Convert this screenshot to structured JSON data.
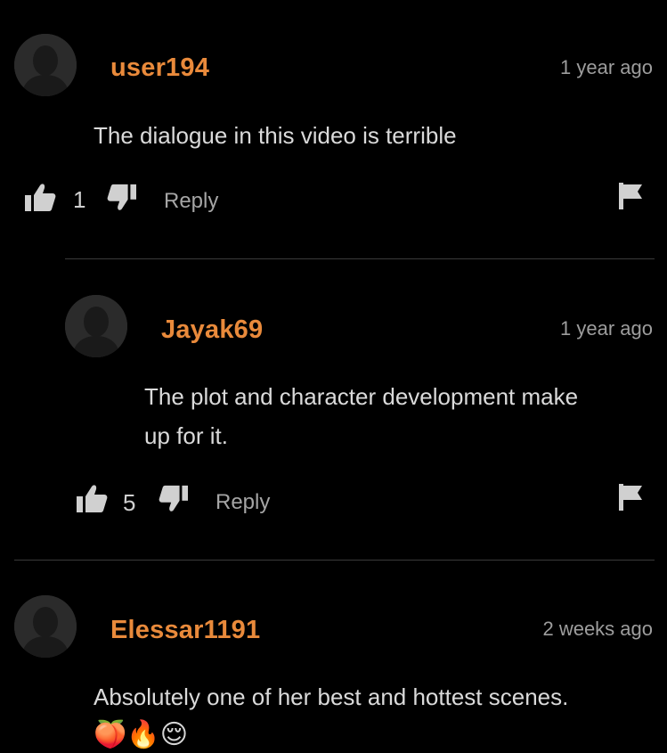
{
  "comments": [
    {
      "username": "user194",
      "timestamp": "1 year ago",
      "text": "The dialogue in this video is terrible",
      "likes": "1",
      "reply_label": "Reply"
    },
    {
      "username": "Jayak69",
      "timestamp": "1 year ago",
      "text_line1": "The plot and character development make",
      "text_line2": "up for it.",
      "likes": "5",
      "reply_label": "Reply"
    },
    {
      "username": "Elessar1191",
      "timestamp": "2 weeks ago",
      "text": "Absolutely one of her best and hottest scenes.",
      "emojis": "🍑🔥😌"
    }
  ],
  "colors": {
    "username": "#e98a3b",
    "background": "#000000",
    "text": "#dadada",
    "muted": "#9d9d9d",
    "divider": "#3a3a3a"
  },
  "icons": {
    "like": "thumbs-up-icon",
    "dislike": "thumbs-down-icon",
    "flag": "flag-icon",
    "avatar": "default-avatar-icon"
  }
}
